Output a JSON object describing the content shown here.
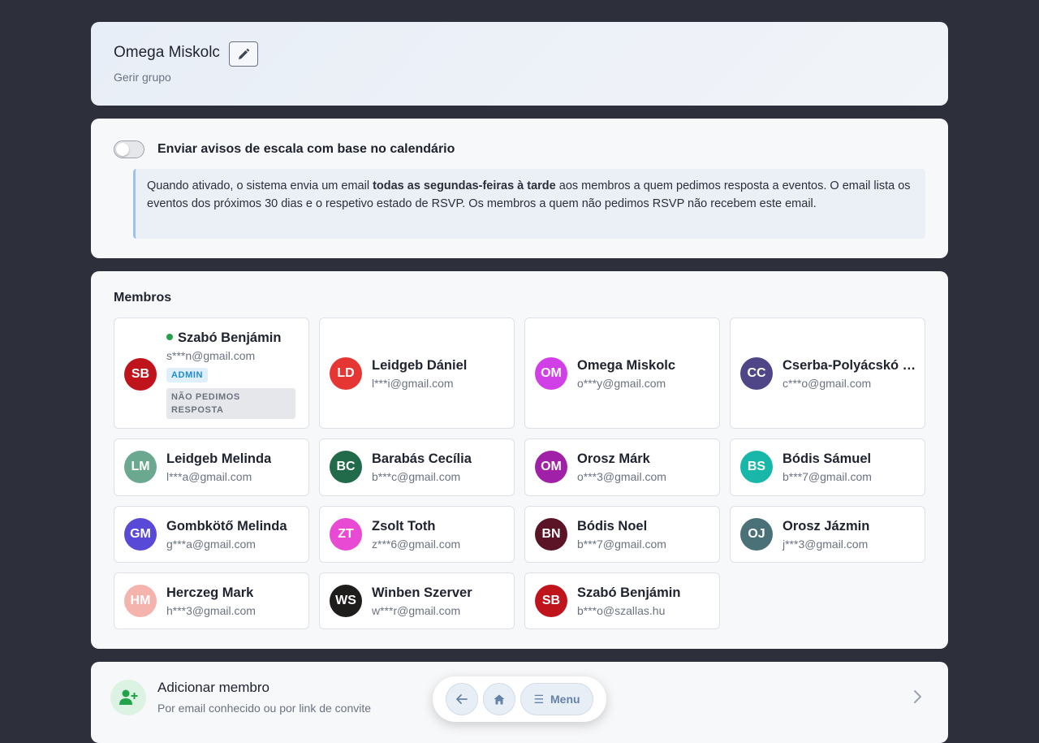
{
  "header": {
    "title": "Omega Miskolc",
    "subtitle": "Gerir grupo",
    "edit_icon": "pencil-icon"
  },
  "reminder": {
    "enabled": false,
    "label": "Enviar avisos de escala com base no calendário",
    "info_part1": "Quando ativado, o sistema envia um email ",
    "info_bold": "todas as segundas-feiras à tarde",
    "info_part2": " aos membros a quem pedimos resposta a eventos. O email lista os eventos dos próximos 30 dias e o respetivo estado de RSVP. Os membros a quem não pedimos RSVP não recebem este email."
  },
  "members": {
    "title": "Membros",
    "items": [
      {
        "initials": "SB",
        "name": "Szabó Benjámin",
        "email": "s***n@gmail.com",
        "color": "#c0141d",
        "online": true,
        "badge_admin": "ADMIN",
        "badge_rsvp": "NÃO PEDIMOS RESPOSTA"
      },
      {
        "initials": "LD",
        "name": "Leidgeb Dániel",
        "email": "l***i@gmail.com",
        "color": "#e63634"
      },
      {
        "initials": "OM",
        "name": "Omega Miskolc",
        "email": "o***y@gmail.com",
        "color": "#d13fe6"
      },
      {
        "initials": "CC",
        "name": "Cserba-Polyácskó Csaba",
        "email": "c***o@gmail.com",
        "color": "#4f4687"
      },
      {
        "initials": "LM",
        "name": "Leidgeb Melinda",
        "email": "l***a@gmail.com",
        "color": "#6aa890"
      },
      {
        "initials": "BC",
        "name": "Barabás Cecília",
        "email": "b***c@gmail.com",
        "color": "#226b4a"
      },
      {
        "initials": "OM",
        "name": "Orosz Márk",
        "email": "o***3@gmail.com",
        "color": "#a020a8"
      },
      {
        "initials": "BS",
        "name": "Bódis Sámuel",
        "email": "b***7@gmail.com",
        "color": "#19b7aa"
      },
      {
        "initials": "GM",
        "name": "Gombkötő Melinda",
        "email": "g***a@gmail.com",
        "color": "#5849d6"
      },
      {
        "initials": "ZT",
        "name": "Zsolt Toth",
        "email": "z***6@gmail.com",
        "color": "#e84ad4"
      },
      {
        "initials": "BN",
        "name": "Bódis Noel",
        "email": "b***7@gmail.com",
        "color": "#5a1426"
      },
      {
        "initials": "OJ",
        "name": "Orosz Jázmin",
        "email": "j***3@gmail.com",
        "color": "#4a7078"
      },
      {
        "initials": "HM",
        "name": "Herczeg Mark",
        "email": "h***3@gmail.com",
        "color": "#f4b3ad"
      },
      {
        "initials": "WS",
        "name": "Winben Szerver",
        "email": "w***r@gmail.com",
        "color": "#1f1d1c"
      },
      {
        "initials": "SB",
        "name": "Szabó Benjámin",
        "email": "b***o@szallas.hu",
        "color": "#c0141d"
      }
    ]
  },
  "add_member": {
    "title": "Adicionar membro",
    "subtitle": "Por email conhecido ou por link de convite",
    "icon": "add-user-icon",
    "icon_color": "#22a34a"
  },
  "nav": {
    "back_icon": "arrow-left-icon",
    "home_icon": "home-icon",
    "menu_label": "Menu"
  }
}
